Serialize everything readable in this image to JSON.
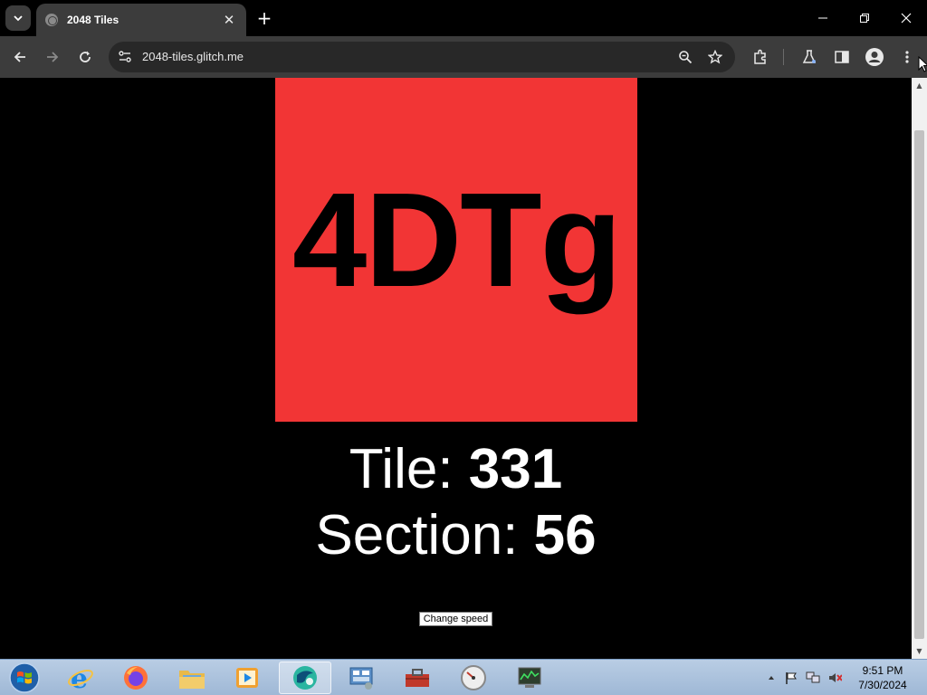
{
  "browser": {
    "tab": {
      "title": "2048 Tiles"
    },
    "address_bar": {
      "url": "2048-tiles.glitch.me"
    }
  },
  "page": {
    "tile_text": "4DTg",
    "tile_color": "#f23535",
    "tile_label": "Tile:",
    "tile_number": "331",
    "section_label": "Section:",
    "section_number": "56",
    "speed_button": "Change speed"
  },
  "taskbar": {
    "apps": [
      {
        "name": "internet-explorer"
      },
      {
        "name": "firefox"
      },
      {
        "name": "file-explorer"
      },
      {
        "name": "media-player"
      },
      {
        "name": "chrome-like-app",
        "active": true
      },
      {
        "name": "control-panel"
      },
      {
        "name": "toolbox"
      },
      {
        "name": "speedometer"
      },
      {
        "name": "task-manager"
      }
    ],
    "clock": {
      "time": "9:51 PM",
      "date": "7/30/2024"
    }
  }
}
